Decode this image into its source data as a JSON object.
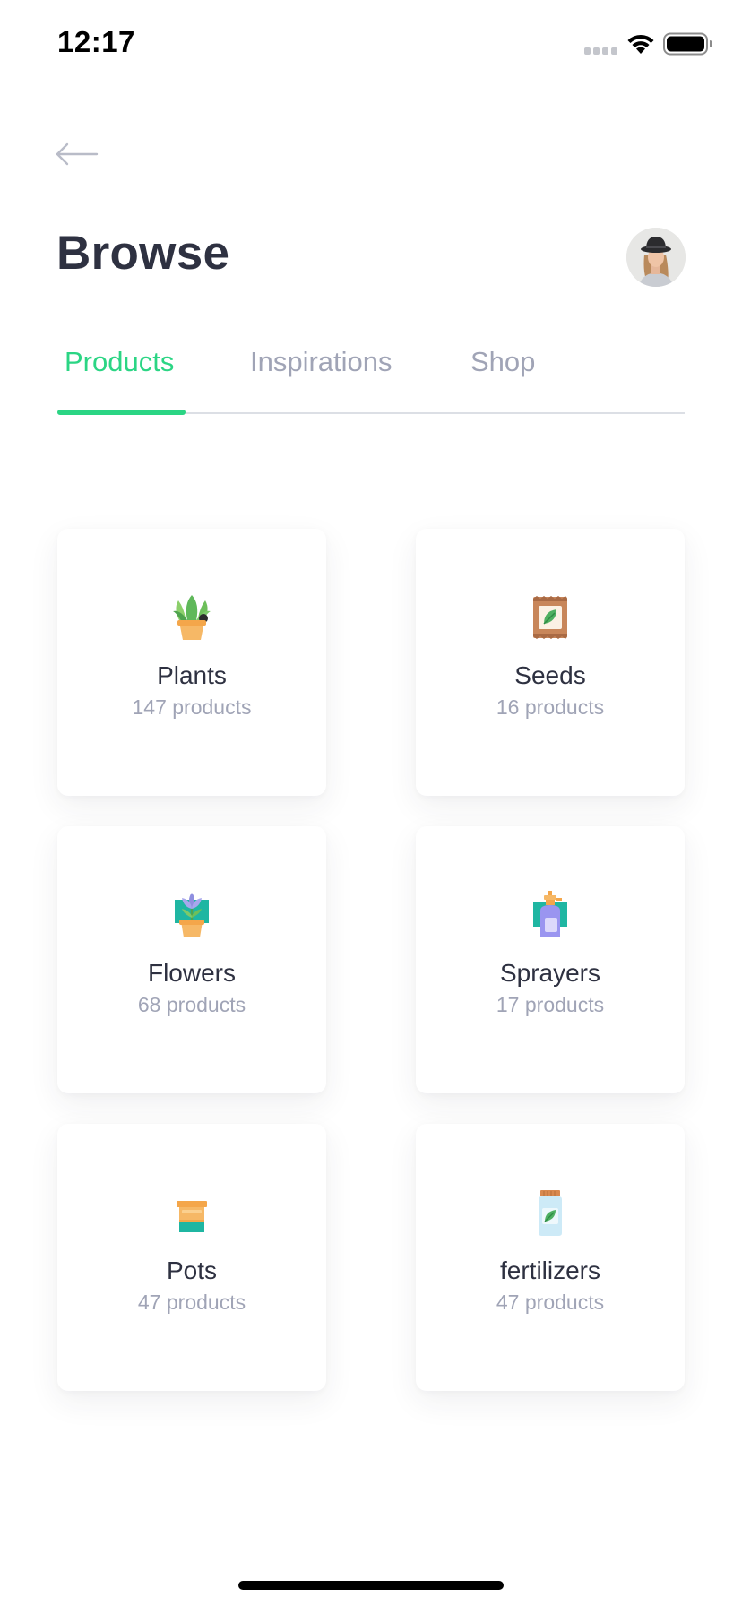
{
  "status_bar": {
    "time": "12:17",
    "icons": [
      "signal-dots-icon",
      "wifi-icon",
      "battery-icon"
    ]
  },
  "header": {
    "back_icon": "arrow-left-icon",
    "title": "Browse",
    "avatar": "user-avatar"
  },
  "tabs": [
    {
      "label": "Products",
      "active": true
    },
    {
      "label": "Inspirations",
      "active": false
    },
    {
      "label": "Shop",
      "active": false
    }
  ],
  "categories": [
    {
      "name": "Plants",
      "count": "147 products",
      "icon": "potted-plant-icon"
    },
    {
      "name": "Seeds",
      "count": "16 products",
      "icon": "seed-packet-icon"
    },
    {
      "name": "Flowers",
      "count": "68 products",
      "icon": "flower-pot-icon"
    },
    {
      "name": "Sprayers",
      "count": "17 products",
      "icon": "sprayer-bottle-icon"
    },
    {
      "name": "Pots",
      "count": "47 products",
      "icon": "pot-icon"
    },
    {
      "name": "fertilizers",
      "count": "47 products",
      "icon": "fertilizer-jar-icon"
    }
  ],
  "colors": {
    "accent": "#2bd584",
    "title_text": "#2e3141",
    "muted_text": "#a0a4b6",
    "divider": "#dcdfe5",
    "background": "#ffffff"
  }
}
